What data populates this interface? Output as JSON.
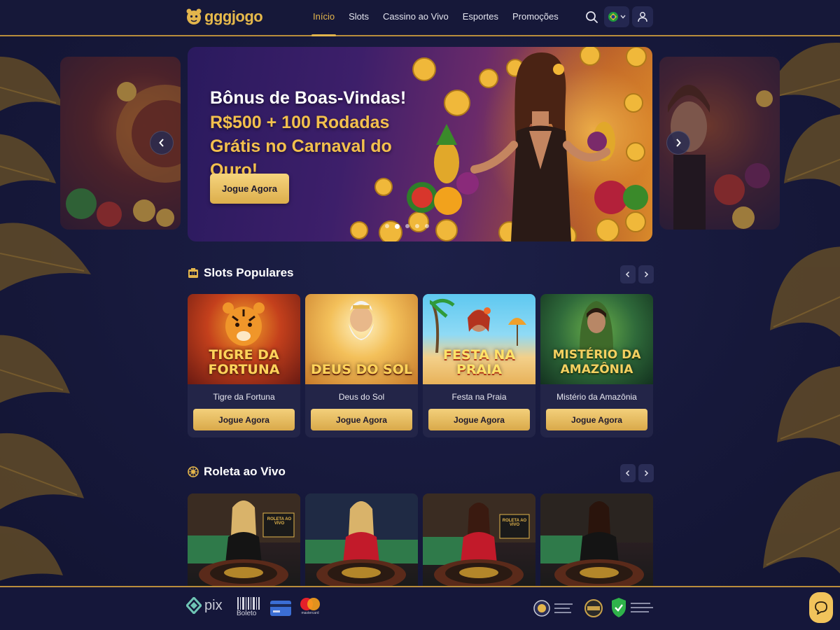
{
  "brand": {
    "name": "gggjogo"
  },
  "nav": {
    "items": [
      {
        "label": "Início",
        "active": true
      },
      {
        "label": "Slots"
      },
      {
        "label": "Cassino ao Vivo"
      },
      {
        "label": "Esportes"
      },
      {
        "label": "Promoções"
      }
    ],
    "icons": {
      "search": "search-icon",
      "language": "brazil-flag-icon",
      "user": "user-icon"
    }
  },
  "hero": {
    "title": "Bônus de Boas-Vindas!",
    "subtitle": "R$500 + 100 Rodadas Grátis no Carnaval do Ouro!",
    "cta": "Jogue Agora",
    "slide_count": 5,
    "active_slide": 1
  },
  "slots": {
    "title": "Slots Populares",
    "icon": "slot-machine-icon",
    "games": [
      {
        "name": "Tigre da Fortuna",
        "art_title": "TIGRE DA FORTUNA",
        "cta": "Jogue Agora"
      },
      {
        "name": "Deus do Sol",
        "art_title": "DEUS DO SOL",
        "cta": "Jogue Agora"
      },
      {
        "name": "Festa na Praia",
        "art_title": "FESTA NA PRAIA",
        "cta": "Jogue Agora"
      },
      {
        "name": "Mistério da Amazônia",
        "art_title": "MISTÉRIO DA AMAZÔNIA",
        "cta": "Jogue Agora"
      }
    ]
  },
  "live": {
    "title": "Roleta ao Vivo",
    "icon": "roulette-wheel-icon",
    "tables": [
      {
        "sign": "ROLETA AO VIVO"
      },
      {
        "sign": ""
      },
      {
        "sign": "ROLETA AO VIVO"
      },
      {
        "sign": ""
      }
    ]
  },
  "footer": {
    "payments": [
      {
        "label": "pix",
        "icon": "pix-icon"
      },
      {
        "label": "Boleto",
        "icon": "barcode-icon"
      },
      {
        "label": "",
        "icon": "credit-card-icon"
      },
      {
        "label": "mastercard",
        "icon": "mastercard-icon"
      }
    ],
    "seals": [
      "seal-icon",
      "award-badge-icon",
      "shield-check-icon"
    ]
  },
  "colors": {
    "accent": "#e3b54c",
    "bg": "#16183a",
    "card": "#232548"
  }
}
